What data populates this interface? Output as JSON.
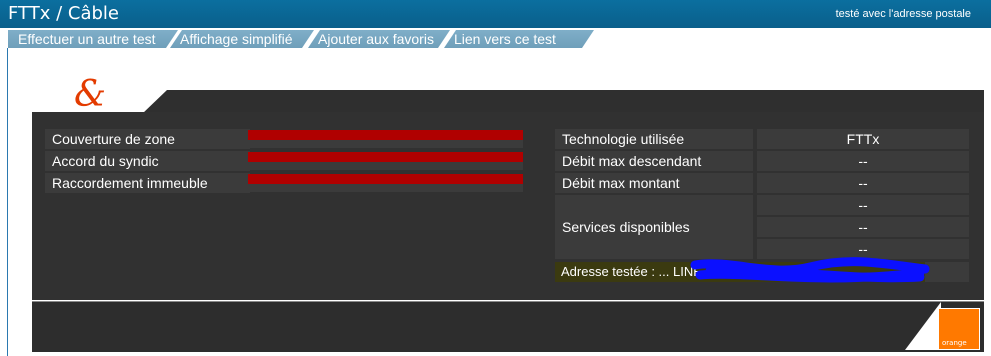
{
  "header": {
    "title": "FTTx / Câble",
    "tested_with": "testé avec l'adresse postale"
  },
  "tabs": [
    {
      "label": "Effectuer un autre test"
    },
    {
      "label": "Affichage simplifié"
    },
    {
      "label": "Ajouter aux favoris"
    },
    {
      "label": "Lien vers ce test"
    }
  ],
  "left_rows": [
    {
      "label": "Couverture de zone"
    },
    {
      "label": "Accord du syndic"
    },
    {
      "label": "Raccordement immeuble"
    }
  ],
  "right_rows": [
    {
      "label": "Technologie utilisée",
      "value": "FTTx"
    },
    {
      "label": "Débit max descendant",
      "value": "--"
    },
    {
      "label": "Débit max montant",
      "value": "--"
    }
  ],
  "services": {
    "label": "Services disponibles",
    "values": [
      "--",
      "--",
      "--"
    ]
  },
  "address": {
    "text": "Adresse testée : ... LINE - 69300 AUX...OIL"
  },
  "branding": {
    "orange_label": "orange"
  },
  "colors": {
    "titlebar": "#0b6f9f",
    "tab": "#7faec8",
    "status_bar_red": "#b00000",
    "orange": "#ff7900"
  }
}
